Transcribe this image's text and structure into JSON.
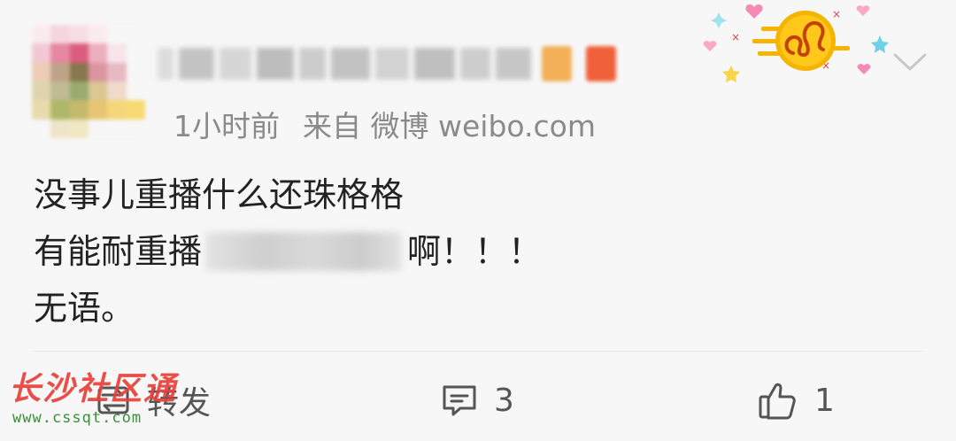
{
  "post": {
    "meta": {
      "time": "1小时前",
      "source": "来自 微博 weibo.com"
    },
    "content": {
      "line1": "没事儿重播什么还珠格格",
      "line2_before": "有能耐重播",
      "line2_after": "啊！！！",
      "line3": "无语。"
    }
  },
  "actions": {
    "repost_label": "转发",
    "comments_count": "3",
    "likes_count": "1"
  },
  "watermark": {
    "text": "长沙社区通",
    "url": "www.cssqt.com"
  },
  "icons": {
    "zodiac_badge": "leo-icon",
    "more": "chevron-down-icon",
    "repost": "repost-icon",
    "comment": "comment-icon",
    "like": "thumbs-up-icon"
  },
  "colors": {
    "background": "#f7f7f7",
    "meta_text": "#8a8a8a",
    "zodiac_gold": "#f5b400",
    "watermark_red": "#e8413a",
    "watermark_green": "#3a8f3a"
  }
}
